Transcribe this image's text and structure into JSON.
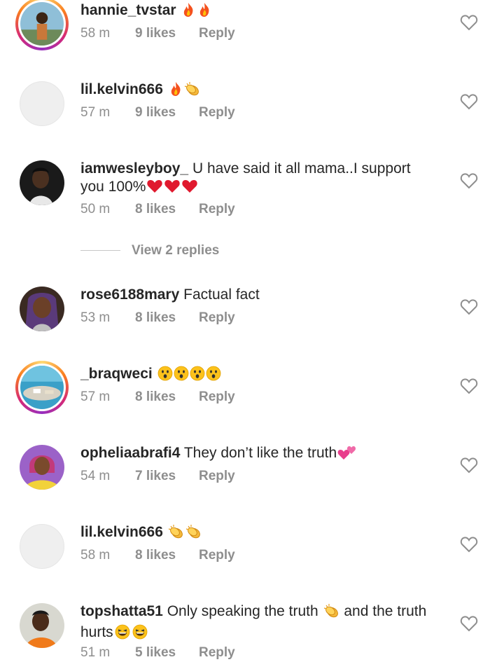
{
  "comments": [
    {
      "username": "hannie_tvstar",
      "text": "",
      "emojis": [
        "fire-emoji",
        "fire-emoji"
      ],
      "time": "58 m",
      "likes": "9 likes",
      "reply": "Reply"
    },
    {
      "username": "lil.kelvin666",
      "text": "",
      "emojis": [
        "fire-emoji",
        "clap-emoji"
      ],
      "time": "57 m",
      "likes": "9 likes",
      "reply": "Reply"
    },
    {
      "username": "iamwesleyboy_",
      "text": "U have said it all mama..I support",
      "text2": "you 100%",
      "emojis": [
        "heart-emoji",
        "heart-emoji",
        "heart-emoji"
      ],
      "time": "50 m",
      "likes": "8 likes",
      "reply": "Reply",
      "view_replies": "View 2 replies"
    },
    {
      "username": "rose6188mary",
      "text": "Factual fact",
      "emojis": [],
      "time": "53 m",
      "likes": "8 likes",
      "reply": "Reply"
    },
    {
      "username": "_braqweci",
      "text": "",
      "emojis": [
        "astonished-emoji",
        "astonished-emoji",
        "astonished-emoji",
        "astonished-emoji"
      ],
      "time": "57 m",
      "likes": "8 likes",
      "reply": "Reply"
    },
    {
      "username": "opheliaabrafi4",
      "text": "They don’t like the truth",
      "emojis": [
        "two-hearts-emoji"
      ],
      "time": "54 m",
      "likes": "7 likes",
      "reply": "Reply"
    },
    {
      "username": "lil.kelvin666",
      "text": "",
      "emojis": [
        "clap-emoji",
        "clap-emoji"
      ],
      "time": "58 m",
      "likes": "8 likes",
      "reply": "Reply"
    },
    {
      "username": "topshatta51",
      "text": "Only speaking the truth",
      "text_after": "and the truth",
      "text2": "hurts",
      "emojis": [
        "clap-emoji"
      ],
      "emojis2": [
        "laugh-emoji",
        "laugh-emoji"
      ],
      "time": "51 m",
      "likes": "5 likes",
      "reply": "Reply"
    }
  ],
  "colors": {
    "text": "#262626",
    "secondary": "#8e8e8e",
    "ring_start": "#feda75",
    "ring_end": "#962fbf"
  }
}
